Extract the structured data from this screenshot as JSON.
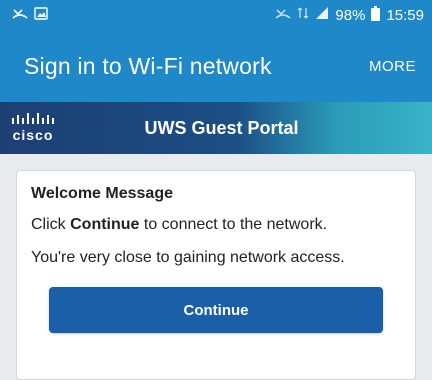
{
  "status_bar": {
    "battery": "98%",
    "time": "15:59"
  },
  "app_bar": {
    "title": "Sign in to Wi-Fi network",
    "more_label": "MORE"
  },
  "portal": {
    "logo_text": "cisco",
    "title": "UWS Guest Portal"
  },
  "welcome": {
    "heading": "Welcome Message",
    "line1_prefix": "Click ",
    "line1_bold": "Continue",
    "line1_suffix": " to connect to the network.",
    "line2": "You're very close to gaining network access.",
    "button_label": "Continue"
  },
  "colors": {
    "app_bar": "#1e88c8",
    "button": "#1a5fa8"
  }
}
